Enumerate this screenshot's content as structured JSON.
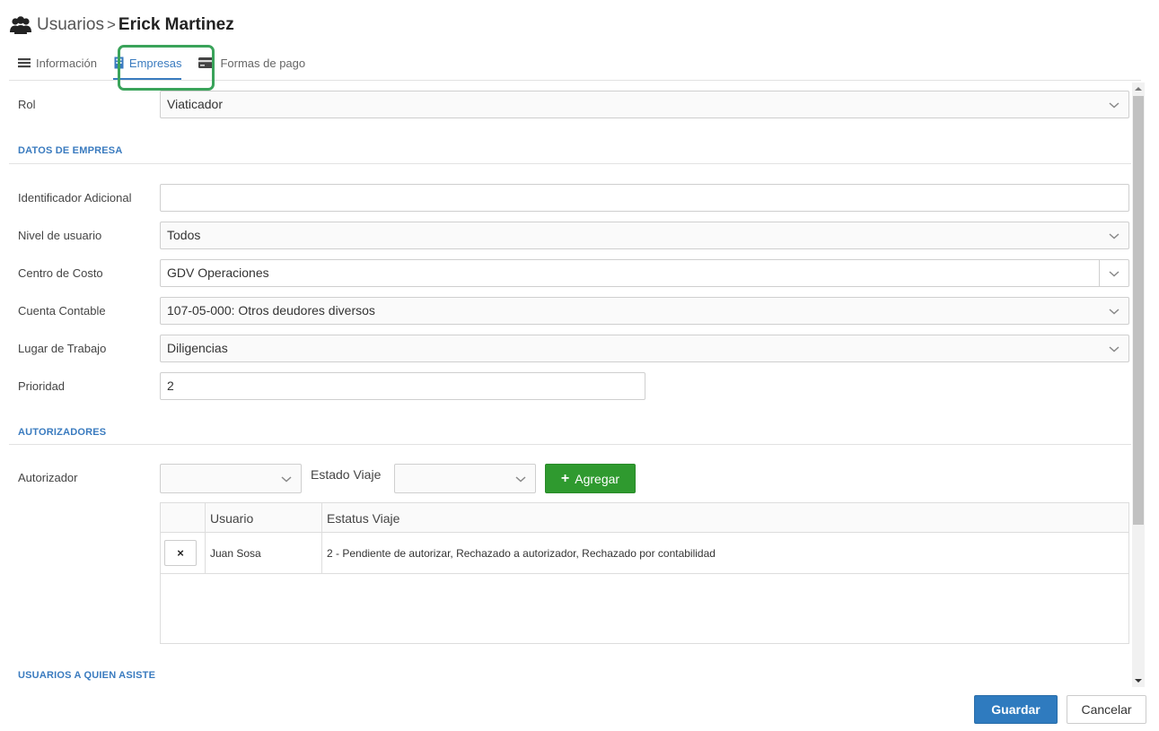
{
  "header": {
    "section": "Usuarios",
    "separator": ">",
    "user_name": "Erick Martinez",
    "icon": "users-icon"
  },
  "tabs": [
    {
      "label": "Información",
      "icon": "list-icon",
      "active": false
    },
    {
      "label": "Empresas",
      "icon": "building-icon",
      "active": true
    },
    {
      "label": "Formas de pago",
      "icon": "credit-card-icon",
      "active": false
    }
  ],
  "form": {
    "rol": {
      "label": "Rol",
      "value": "Viaticador"
    },
    "datos_empresa_title": "DATOS DE EMPRESA",
    "identificador": {
      "label": "Identificador Adicional",
      "value": ""
    },
    "nivel_usuario": {
      "label": "Nivel de usuario",
      "value": "Todos"
    },
    "centro_costo": {
      "label": "Centro de Costo",
      "value": "GDV Operaciones"
    },
    "cuenta_contable": {
      "label": "Cuenta Contable",
      "value": "107-05-000: Otros deudores diversos"
    },
    "lugar_trabajo": {
      "label": "Lugar de Trabajo",
      "value": "Diligencias"
    },
    "prioridad": {
      "label": "Prioridad",
      "value": "2"
    }
  },
  "autorizadores": {
    "title": "AUTORIZADORES",
    "autorizador_label": "Autorizador",
    "autorizador_value": "",
    "estado_viaje_label": "Estado Viaje",
    "estado_viaje_value": "",
    "add_label": "Agregar",
    "table": {
      "columns": [
        "",
        "Usuario",
        "Estatus Viaje"
      ],
      "rows": [
        {
          "delete": "×",
          "usuario": "Juan Sosa",
          "estatus": "2 - Pendiente de autorizar, Rechazado a autorizador, Rechazado por contabilidad"
        }
      ]
    }
  },
  "usuarios_asiste_title": "USUARIOS A QUIEN ASISTE",
  "footer": {
    "save_label": "Guardar",
    "cancel_label": "Cancelar"
  },
  "colors": {
    "accent": "#3a7bbf",
    "success": "#2f9a2f",
    "highlight": "#3aa35a",
    "primary_button": "#2f7bbf"
  }
}
